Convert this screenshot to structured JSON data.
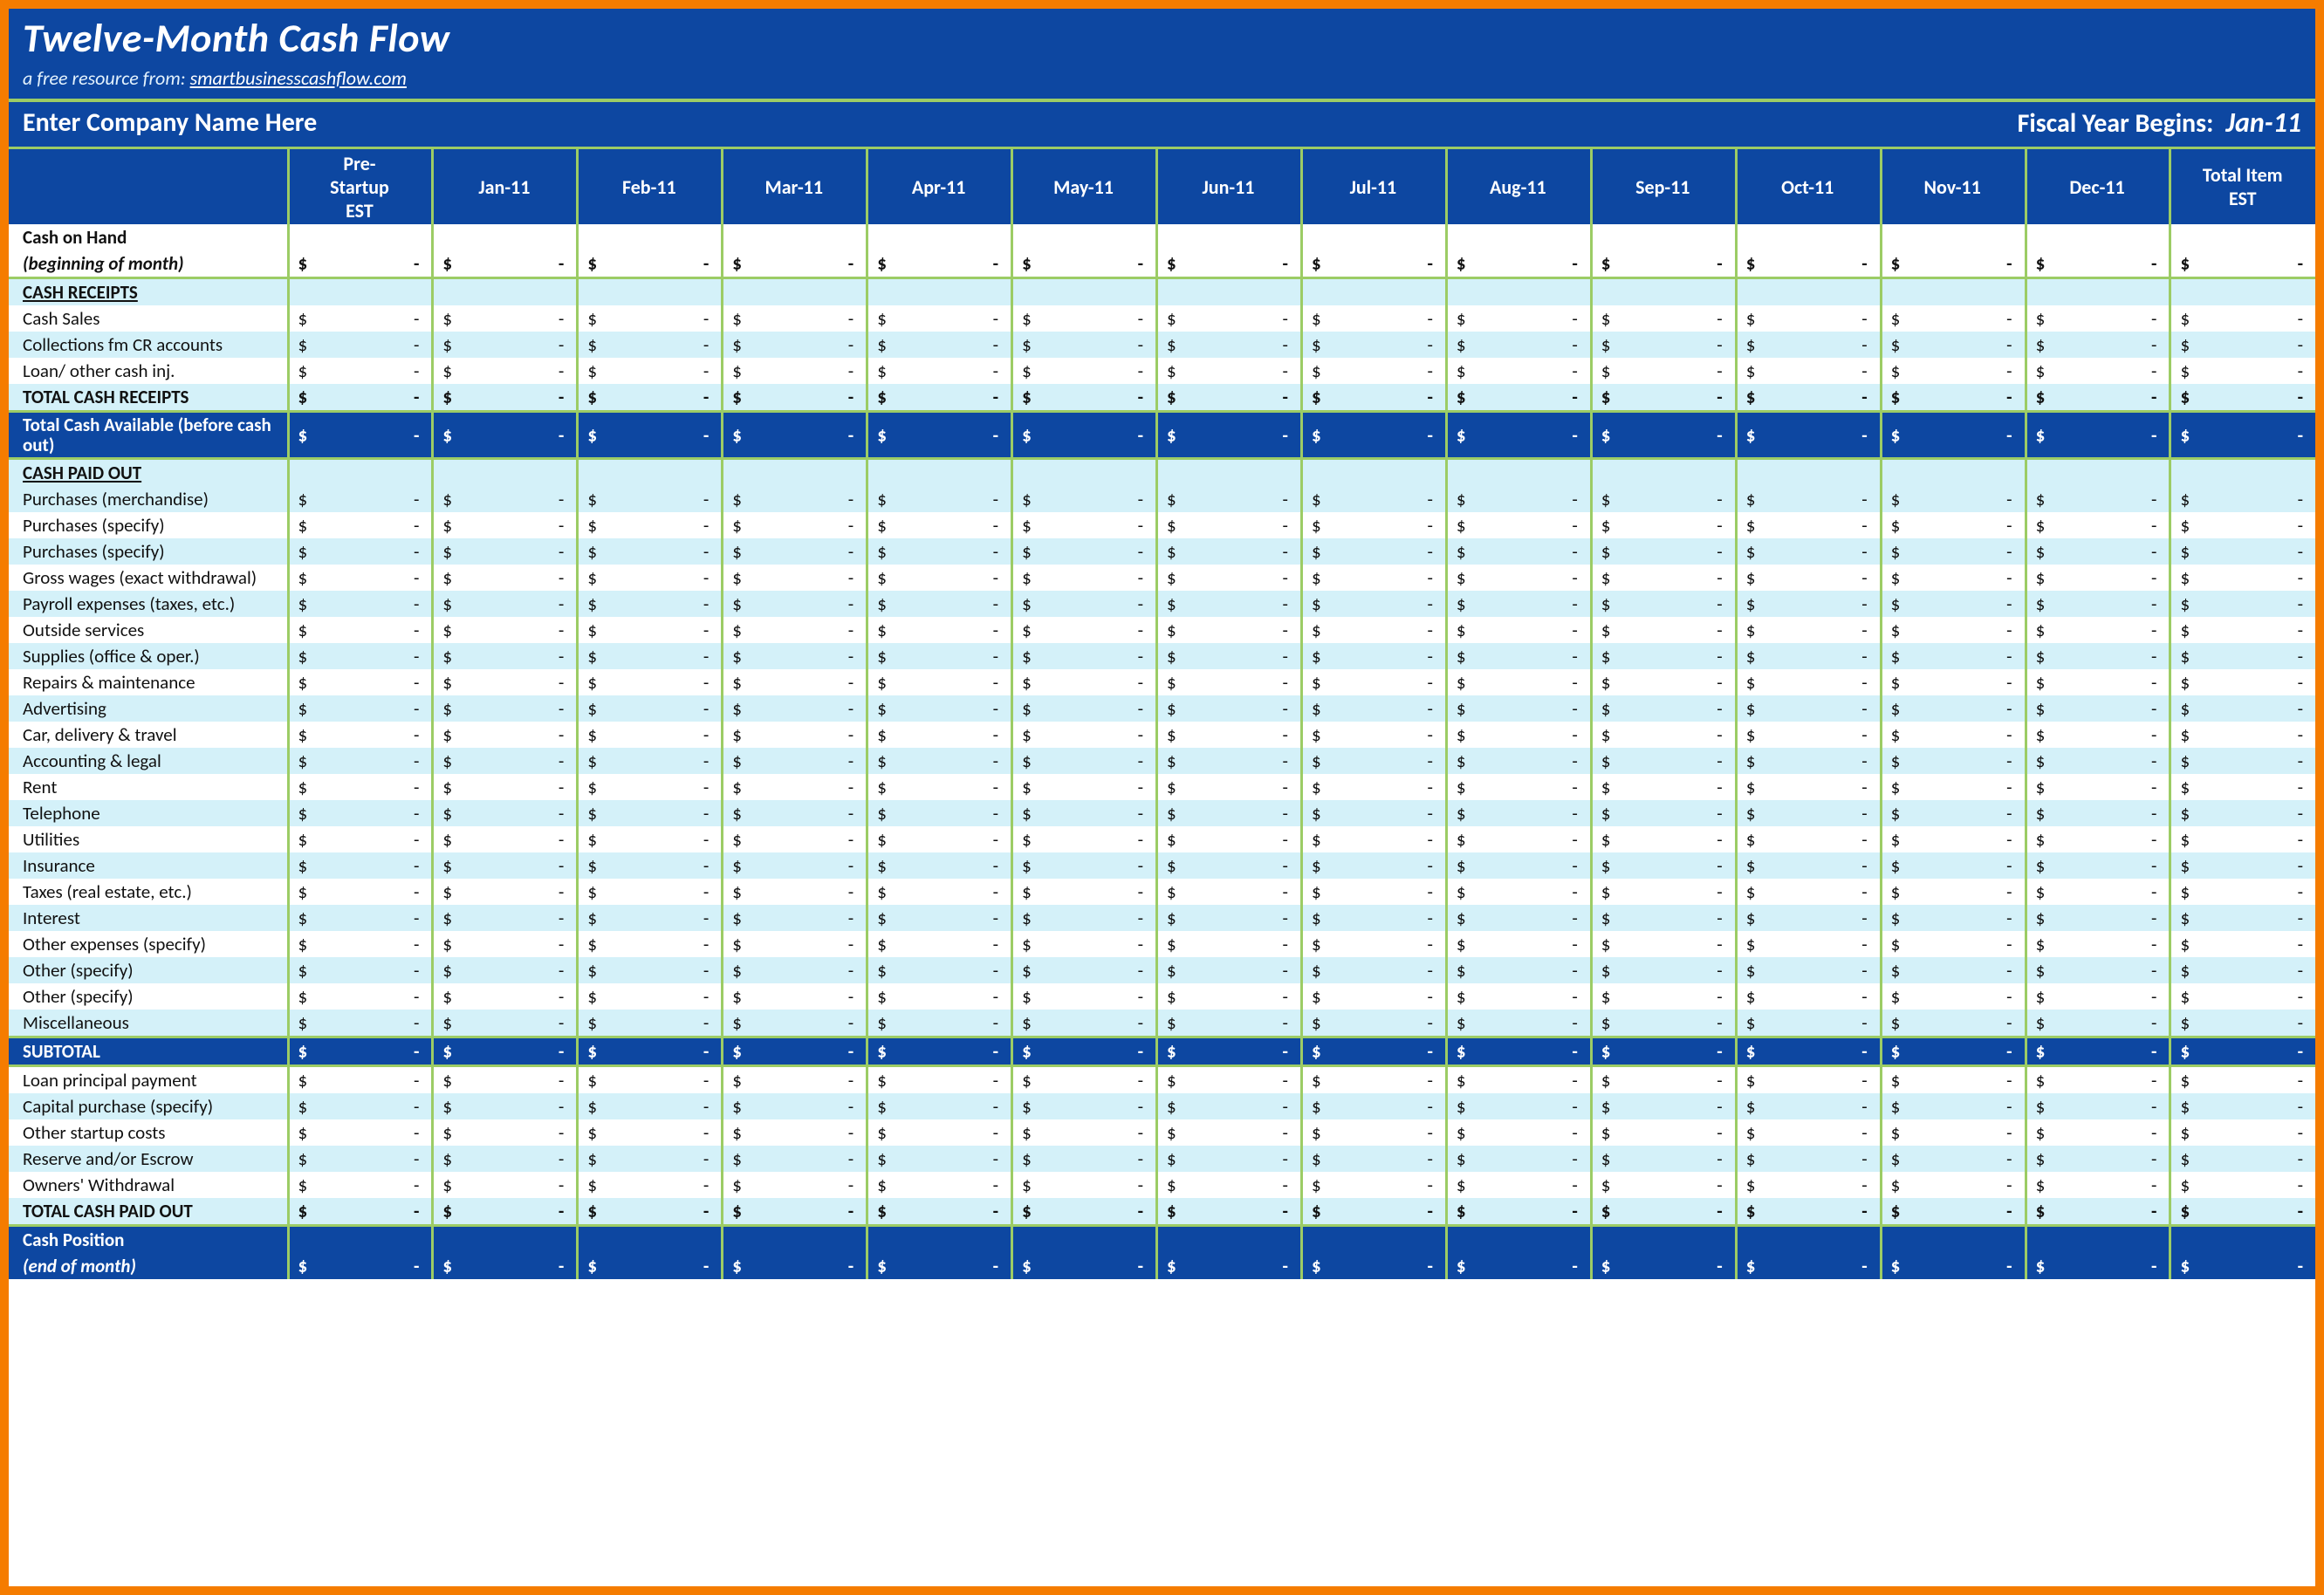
{
  "header": {
    "title": "Twelve-Month Cash Flow",
    "subtitle_prefix": "a free resource from:",
    "subtitle_link": "smartbusinesscashflow.com",
    "company_prompt": "Enter Company Name Here",
    "fiscal_label": "Fiscal Year Begins:",
    "fiscal_value": "Jan-11"
  },
  "columns": [
    "Pre-Startup EST",
    "Jan-11",
    "Feb-11",
    "Mar-11",
    "Apr-11",
    "May-11",
    "Jun-11",
    "Jul-11",
    "Aug-11",
    "Sep-11",
    "Oct-11",
    "Nov-11",
    "Dec-11",
    "Total Item EST"
  ],
  "currency": "$",
  "dash": "-",
  "rows": [
    {
      "label": "Cash on Hand",
      "style": "r-bold-plain",
      "cells": "none"
    },
    {
      "label": "(beginning of month)",
      "style": "r-bold-plain i1",
      "cells": "money"
    },
    {
      "label": "CASH RECEIPTS",
      "style": "r-section topline",
      "cells": "none"
    },
    {
      "label": "Cash Sales",
      "style": "r-plain",
      "cells": "money"
    },
    {
      "label": "Collections fm CR accounts",
      "style": "r-band",
      "cells": "money"
    },
    {
      "label": "Loan/ other cash inj.",
      "style": "r-plain",
      "cells": "money"
    },
    {
      "label": "TOTAL CASH RECEIPTS",
      "style": "r-bold-band",
      "cells": "money"
    },
    {
      "label": "Total Cash Available (before cash out)",
      "style": "r-blue wrap topline",
      "two": true,
      "cells": "money"
    },
    {
      "label": "CASH PAID OUT",
      "style": "r-section topline",
      "cells": "none"
    },
    {
      "label": "Purchases (merchandise)",
      "style": "r-band",
      "cells": "money"
    },
    {
      "label": "Purchases (specify)",
      "style": "r-plain",
      "cells": "money"
    },
    {
      "label": "Purchases (specify)",
      "style": "r-band",
      "cells": "money"
    },
    {
      "label": "Gross wages (exact withdrawal)",
      "style": "r-plain",
      "cells": "money"
    },
    {
      "label": "Payroll expenses (taxes, etc.)",
      "style": "r-band",
      "cells": "money"
    },
    {
      "label": "Outside services",
      "style": "r-plain",
      "cells": "money"
    },
    {
      "label": "Supplies (office & oper.)",
      "style": "r-band",
      "cells": "money"
    },
    {
      "label": "Repairs & maintenance",
      "style": "r-plain",
      "cells": "money"
    },
    {
      "label": "Advertising",
      "style": "r-band",
      "cells": "money"
    },
    {
      "label": "Car, delivery & travel",
      "style": "r-plain",
      "cells": "money"
    },
    {
      "label": "Accounting & legal",
      "style": "r-band",
      "cells": "money"
    },
    {
      "label": "Rent",
      "style": "r-plain",
      "cells": "money"
    },
    {
      "label": "Telephone",
      "style": "r-band",
      "cells": "money"
    },
    {
      "label": "Utilities",
      "style": "r-plain",
      "cells": "money"
    },
    {
      "label": "Insurance",
      "style": "r-band",
      "cells": "money"
    },
    {
      "label": "Taxes (real estate, etc.)",
      "style": "r-plain",
      "cells": "money"
    },
    {
      "label": "Interest",
      "style": "r-band",
      "cells": "money"
    },
    {
      "label": "Other expenses (specify)",
      "style": "r-plain",
      "cells": "money"
    },
    {
      "label": "Other (specify)",
      "style": "r-band",
      "cells": "money"
    },
    {
      "label": "Other (specify)",
      "style": "r-plain",
      "cells": "money"
    },
    {
      "label": "Miscellaneous",
      "style": "r-band",
      "cells": "money"
    },
    {
      "label": "SUBTOTAL",
      "style": "r-blue topline",
      "cells": "money"
    },
    {
      "label": "Loan principal payment",
      "style": "r-plain topline",
      "cells": "money"
    },
    {
      "label": "Capital purchase (specify)",
      "style": "r-band",
      "cells": "money"
    },
    {
      "label": "Other startup costs",
      "style": "r-plain",
      "cells": "money"
    },
    {
      "label": "Reserve and/or Escrow",
      "style": "r-band",
      "cells": "money"
    },
    {
      "label": "Owners' Withdrawal",
      "style": "r-plain",
      "cells": "money"
    },
    {
      "label": "TOTAL CASH PAID OUT",
      "style": "r-bold-band",
      "cells": "money"
    },
    {
      "label": "Cash Position",
      "style": "r-blue topline",
      "cells": "none"
    },
    {
      "label": "(end of month)",
      "style": "r-blue-ital",
      "cells": "money"
    }
  ]
}
